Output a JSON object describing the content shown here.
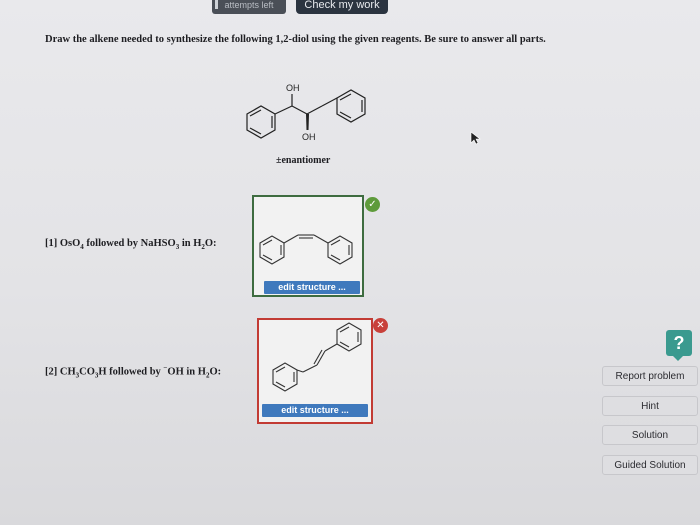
{
  "header": {
    "attempts_label": "attempts left",
    "check_button": "Check my work"
  },
  "question": {
    "instructions": "Draw the alkene needed to synthesize the following 1,2-diol using the given reagents. Be sure to answer all parts.",
    "product": {
      "oh_top": "OH",
      "oh_bottom": "OH",
      "caption": "±enantiomer"
    }
  },
  "parts": [
    {
      "label_pre": "[1] OsO",
      "label_sub1": "4",
      "label_mid": " followed by NaHSO",
      "label_sub2": "3",
      "label_mid2": " in H",
      "label_sub3": "2",
      "label_post": "O:",
      "status": "correct",
      "edit_label": "edit structure ..."
    },
    {
      "label_pre": "[2] CH",
      "label_sub1": "3",
      "label_mid": "CO",
      "label_sub2": "3",
      "label_mid2": "H followed by ",
      "label_sup": "−",
      "label_mid3": "OH in H",
      "label_sub3": "2",
      "label_post": "O:",
      "status": "incorrect",
      "edit_label": "edit structure ..."
    }
  ],
  "sidebar": {
    "help_label": "?",
    "buttons": [
      "Report problem",
      "Hint",
      "Solution",
      "Guided Solution"
    ]
  },
  "colors": {
    "correct": "#5e9b3b",
    "incorrect": "#c8403a",
    "edit_button": "#3f79bd",
    "help": "#3a9a8f"
  }
}
